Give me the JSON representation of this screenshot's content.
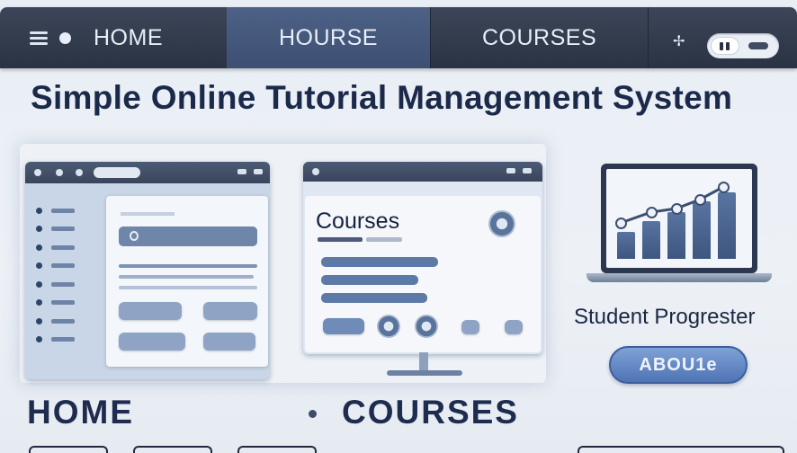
{
  "nav": {
    "home": "HOME",
    "hourse": "HOURSE",
    "courses": "COURSES"
  },
  "title": "Simple Online Tutorial Management System",
  "courses_card": {
    "heading": "Courses"
  },
  "progress": {
    "caption": "Student Progrester"
  },
  "about_button": "ABOU1e",
  "bottom": {
    "home": "HOME",
    "courses": "COURSES"
  },
  "colors": {
    "nav_bg": "#2a3344",
    "accent": "#4f74b4",
    "title": "#1b2a4a"
  },
  "icons": [
    "menu-icon",
    "settings-icon",
    "toggle-icon",
    "chart-icon",
    "fingerprint-icon"
  ]
}
